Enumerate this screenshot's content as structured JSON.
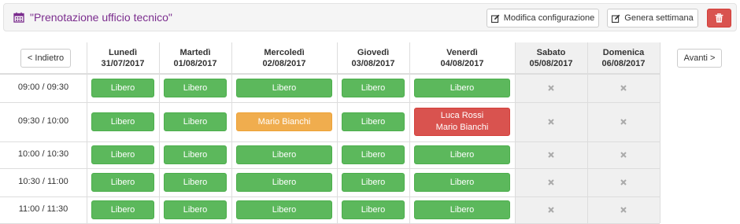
{
  "header": {
    "title": "\"Prenotazione ufficio tecnico\"",
    "title_icon": "calendar-icon",
    "edit_label": "Modifica configurazione",
    "generate_label": "Genera settimana",
    "delete_icon": "trash-icon"
  },
  "nav": {
    "back_label": "< Indietro",
    "forward_label": "Avanti >"
  },
  "days": [
    {
      "name": "Lunedì",
      "date": "31/07/2017",
      "disabled": false
    },
    {
      "name": "Martedì",
      "date": "01/08/2017",
      "disabled": false
    },
    {
      "name": "Mercoledì",
      "date": "02/08/2017",
      "disabled": false
    },
    {
      "name": "Giovedì",
      "date": "03/08/2017",
      "disabled": false
    },
    {
      "name": "Venerdì",
      "date": "04/08/2017",
      "disabled": false
    },
    {
      "name": "Sabato",
      "date": "05/08/2017",
      "disabled": true
    },
    {
      "name": "Domenica",
      "date": "06/08/2017",
      "disabled": true
    }
  ],
  "slots": [
    {
      "time": "09:00 / 09:30",
      "cells": [
        {
          "status": "free",
          "text": [
            "Libero"
          ]
        },
        {
          "status": "free",
          "text": [
            "Libero"
          ]
        },
        {
          "status": "free",
          "text": [
            "Libero"
          ]
        },
        {
          "status": "free",
          "text": [
            "Libero"
          ]
        },
        {
          "status": "free",
          "text": [
            "Libero"
          ]
        },
        {
          "status": "closed"
        },
        {
          "status": "closed"
        }
      ]
    },
    {
      "time": "09:30 / 10:00",
      "cells": [
        {
          "status": "free",
          "text": [
            "Libero"
          ]
        },
        {
          "status": "free",
          "text": [
            "Libero"
          ]
        },
        {
          "status": "partial",
          "text": [
            "Mario Bianchi"
          ]
        },
        {
          "status": "free",
          "text": [
            "Libero"
          ]
        },
        {
          "status": "full",
          "text": [
            "Luca Rossi",
            "Mario Bianchi"
          ]
        },
        {
          "status": "closed"
        },
        {
          "status": "closed"
        }
      ]
    },
    {
      "time": "10:00 / 10:30",
      "cells": [
        {
          "status": "free",
          "text": [
            "Libero"
          ]
        },
        {
          "status": "free",
          "text": [
            "Libero"
          ]
        },
        {
          "status": "free",
          "text": [
            "Libero"
          ]
        },
        {
          "status": "free",
          "text": [
            "Libero"
          ]
        },
        {
          "status": "free",
          "text": [
            "Libero"
          ]
        },
        {
          "status": "closed"
        },
        {
          "status": "closed"
        }
      ]
    },
    {
      "time": "10:30 / 11:00",
      "cells": [
        {
          "status": "free",
          "text": [
            "Libero"
          ]
        },
        {
          "status": "free",
          "text": [
            "Libero"
          ]
        },
        {
          "status": "free",
          "text": [
            "Libero"
          ]
        },
        {
          "status": "free",
          "text": [
            "Libero"
          ]
        },
        {
          "status": "free",
          "text": [
            "Libero"
          ]
        },
        {
          "status": "closed"
        },
        {
          "status": "closed"
        }
      ]
    },
    {
      "time": "11:00 / 11:30",
      "cells": [
        {
          "status": "free",
          "text": [
            "Libero"
          ]
        },
        {
          "status": "free",
          "text": [
            "Libero"
          ]
        },
        {
          "status": "free",
          "text": [
            "Libero"
          ]
        },
        {
          "status": "free",
          "text": [
            "Libero"
          ]
        },
        {
          "status": "free",
          "text": [
            "Libero"
          ]
        },
        {
          "status": "closed"
        },
        {
          "status": "closed"
        }
      ]
    }
  ],
  "colors": {
    "free": "#5cb85c",
    "partial": "#f0ad4e",
    "full": "#d9534f",
    "title": "#7b2d8e",
    "closed_bg": "#f0f0f0"
  }
}
